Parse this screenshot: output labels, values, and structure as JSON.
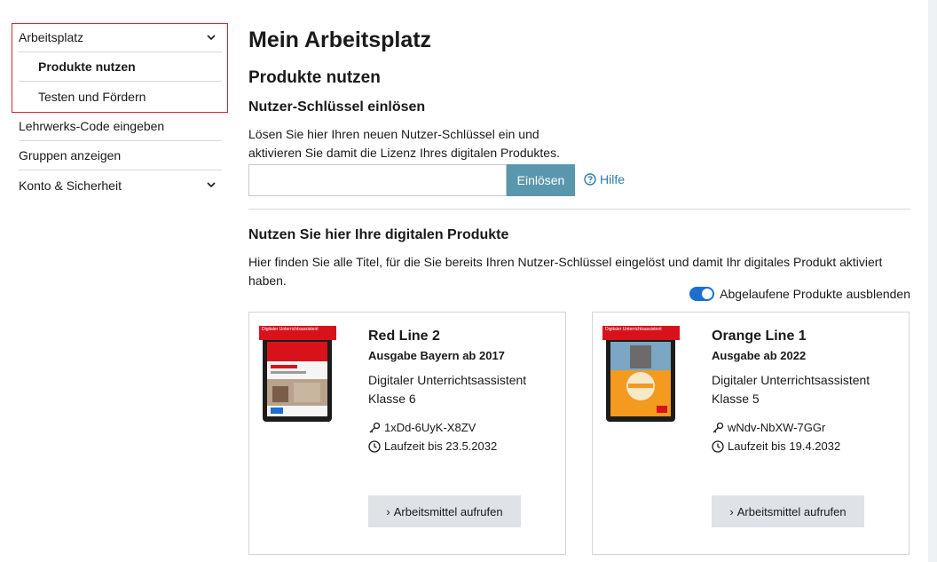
{
  "sidebar": {
    "items": [
      {
        "label": "Arbeitsplatz",
        "expandable": true
      },
      {
        "label": "Produkte nutzen",
        "active": true
      },
      {
        "label": "Testen und Fördern"
      },
      {
        "label": "Lehrwerks-Code eingeben"
      },
      {
        "label": "Gruppen anzeigen"
      },
      {
        "label": "Konto & Sicherheit",
        "expandable": true
      }
    ]
  },
  "main": {
    "title": "Mein Arbeitsplatz",
    "section_title": "Produkte nutzen",
    "key_title": "Nutzer-Schlüssel einlösen",
    "key_desc_line1": "Lösen Sie hier Ihren neuen Nutzer-Schlüssel ein und",
    "key_desc_line2": "aktivieren Sie damit die Lizenz Ihres digitalen Produktes.",
    "key_input_value": "",
    "redeem_label": "Einlösen",
    "help_label": "Hilfe",
    "products_title": "Nutzen Sie hier Ihre digitalen Produkte",
    "products_desc": "Hier finden Sie alle Titel, für die Sie bereits Ihren Nutzer-Schlüssel eingelöst und damit Ihr digitales Produkt aktiviert haben.",
    "toggle_label": "Abgelaufene Produkte ausblenden",
    "toggle_on": true
  },
  "products": [
    {
      "title": "Red Line 2",
      "edition": "Ausgabe Bayern ab 2017",
      "type": "Digitaler Unterrichtsassistent",
      "grade": "Klasse 6",
      "code": "1xDd-6UyK-X8ZV",
      "runtime": "Laufzeit bis 23.5.2032",
      "button": "Arbeitsmittel aufrufen",
      "cover_banner": "Digitaler Unterrichtsassistent"
    },
    {
      "title": "Orange Line 1",
      "edition": "Ausgabe ab 2022",
      "type": "Digitaler Unterrichtsassistent",
      "grade": "Klasse 5",
      "code": "wNdv-NbXW-7GGr",
      "runtime": "Laufzeit bis 19.4.2032",
      "button": "Arbeitsmittel aufrufen",
      "cover_banner": "Digitaler Unterrichtsassistent"
    }
  ],
  "colors": {
    "accent_button": "#5a97ad",
    "link": "#2b7ea5",
    "toggle": "#1a6fd1",
    "highlight_border": "#d9252f"
  }
}
